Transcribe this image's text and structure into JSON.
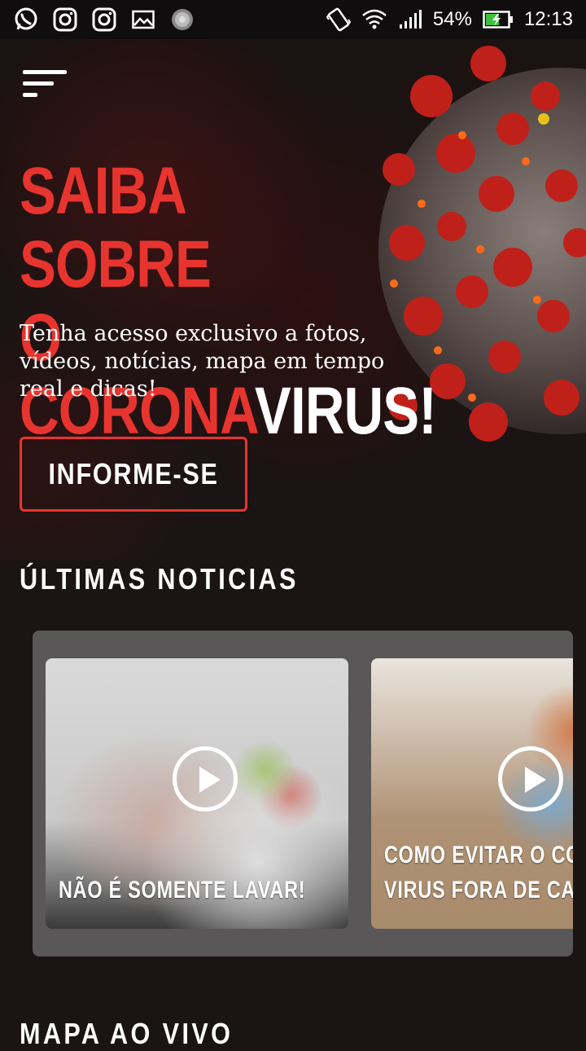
{
  "status_bar": {
    "left_icons": [
      "whatsapp-icon",
      "instagram-icon",
      "instagram-icon",
      "gallery-icon",
      "loading-icon"
    ],
    "battery": "54%",
    "time": "12:13"
  },
  "hero": {
    "headline_line1": "SAIBA SOBRE",
    "headline_line2_red": "O CORONA",
    "headline_line2_white": "VIRUS!",
    "subtext": "Tenha acesso exclusivo a fotos, vídeos, notícias, mapa em tempo real e dicas!",
    "cta_label": "INFORME-SE"
  },
  "news": {
    "title": "ÚLTIMAS NOTICIAS",
    "cards": [
      {
        "caption": "NÃO É SOMENTE LAVAR!"
      },
      {
        "caption": "COMO EVITAR O CORONA\nVIRUS FORA DE CASA"
      }
    ]
  },
  "map": {
    "title": "MAPA AO VIVO"
  },
  "colors": {
    "accent": "#e8342f",
    "background": "#1a1414"
  }
}
